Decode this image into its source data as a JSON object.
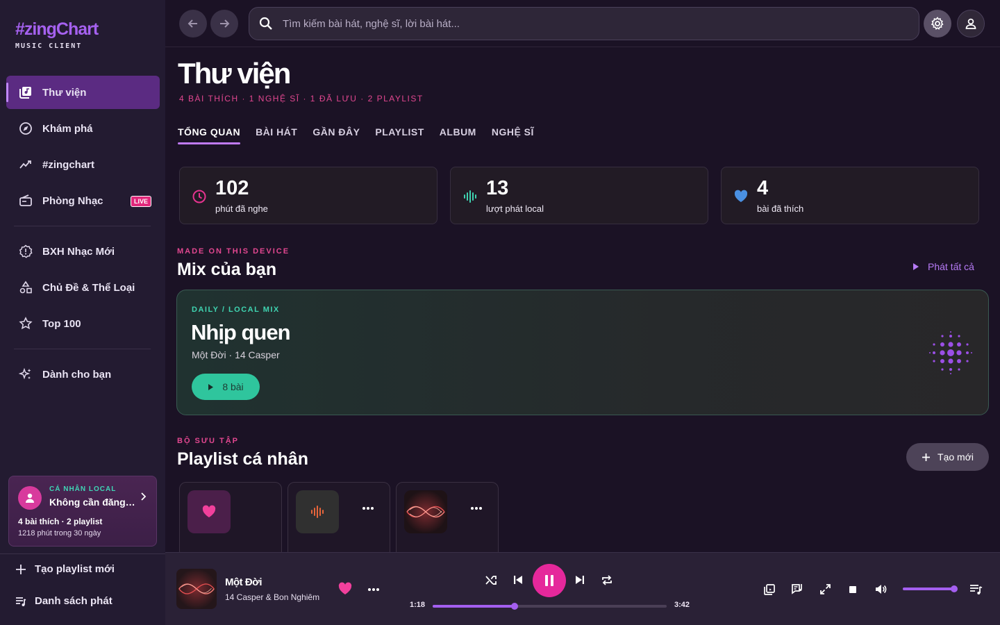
{
  "brand": {
    "title": "#zingChart",
    "subtitle": "MUSIC CLIENT"
  },
  "sidebar": {
    "nav": [
      {
        "label": "Thư viện",
        "icon": "library-icon",
        "active": true
      },
      {
        "label": "Khám phá",
        "icon": "compass-icon"
      },
      {
        "label": "#zingchart",
        "icon": "trend-icon"
      },
      {
        "label": "Phòng Nhạc",
        "icon": "radio-icon",
        "badge": "LIVE"
      },
      {
        "label": "BXH Nhạc Mới",
        "icon": "new-chart-icon"
      },
      {
        "label": "Chủ Đề & Thể Loại",
        "icon": "shapes-icon"
      },
      {
        "label": "Top 100",
        "icon": "star-icon"
      },
      {
        "label": "Dành cho bạn",
        "icon": "sparkle-icon"
      }
    ],
    "profile": {
      "tag": "CÁ NHÂN LOCAL",
      "name": "Không cần đăng nhập",
      "stats": "4 bài thích · 2 playlist",
      "minutes": "1218 phút trong 30 ngày"
    },
    "actions": {
      "new_playlist": "Tạo playlist mới",
      "queue": "Danh sách phát"
    }
  },
  "topbar": {
    "search_placeholder": "Tìm kiếm bài hát, nghệ sĩ, lời bài hát..."
  },
  "page": {
    "title": "Thư viện",
    "stats": "4 BÀI THÍCH · 1 NGHỆ SĨ · 1 ĐÃ LƯU · 2 PLAYLIST",
    "tabs": [
      "TỔNG QUAN",
      "BÀI HÁT",
      "GẦN ĐÂY",
      "PLAYLIST",
      "ALBUM",
      "NGHỆ SĨ"
    ],
    "active_tab": "TỔNG QUAN"
  },
  "stat_cards": [
    {
      "value": "102",
      "label": "phút đã nghe",
      "icon": "clock-icon",
      "color": "#e6338f"
    },
    {
      "value": "13",
      "label": "lượt phát local",
      "icon": "waveform-icon",
      "color": "#3fd4b1"
    },
    {
      "value": "4",
      "label": "bài đã thích",
      "icon": "heart-icon",
      "color": "#4a90e2"
    }
  ],
  "mix_section": {
    "tag": "MADE ON THIS DEVICE",
    "title": "Mix của bạn",
    "play_all": "Phát tất cả",
    "card": {
      "tag": "DAILY / LOCAL MIX",
      "title": "Nhịp quen",
      "subtitle": "Một Đời · 14 Casper",
      "button": "8 bài"
    }
  },
  "playlist_section": {
    "tag": "BỘ SƯU TẬP",
    "title": "Playlist cá nhân",
    "create": "Tạo mới"
  },
  "player": {
    "title": "Một Đời",
    "artist": "14 Casper & Bon Nghiêm",
    "current_time": "1:18",
    "duration": "3:42",
    "progress": 0.35,
    "volume": 1.0,
    "liked": true,
    "playing": true
  },
  "colors": {
    "accent": "#a561ef",
    "pink": "#e5289b",
    "teal": "#2fc59d",
    "background": "#1b1225",
    "sidebar": "#231b31"
  }
}
